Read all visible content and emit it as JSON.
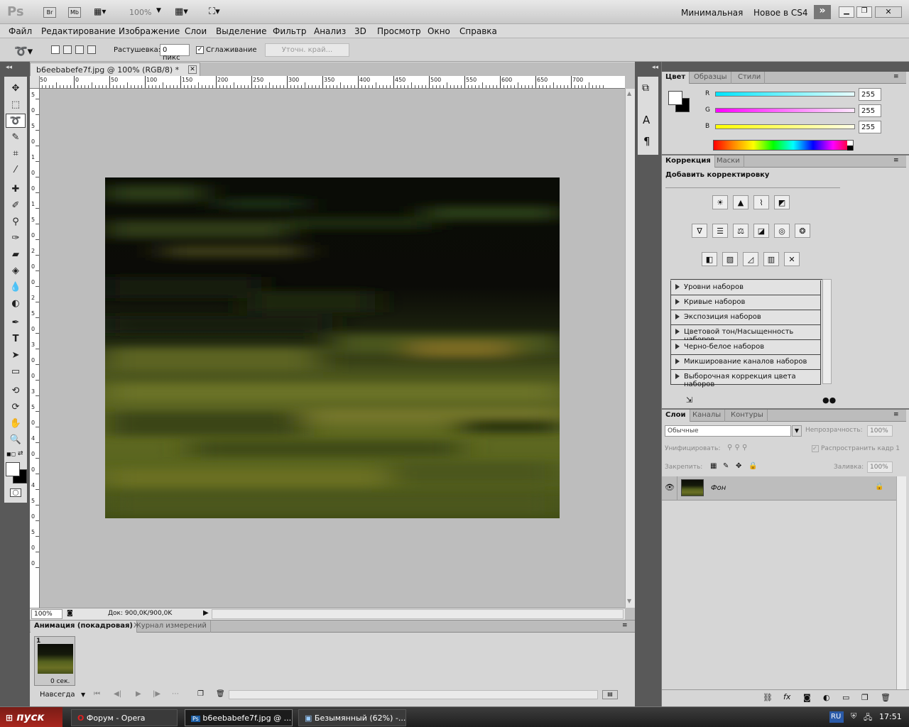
{
  "appbar": {
    "logo": "Ps",
    "br_btn": "Br",
    "mb_btn": "Mb",
    "zoom": "100%",
    "workspace_minimal": "Минимальная",
    "workspace_new": "Новое в CS4"
  },
  "menu": [
    "Файл",
    "Редактирование",
    "Изображение",
    "Слои",
    "Выделение",
    "Фильтр",
    "Анализ",
    "3D",
    "Просмотр",
    "Окно",
    "Справка"
  ],
  "options": {
    "feather_label": "Растушевка:",
    "feather_value": "0 пикс",
    "antialias_label": "Сглаживание",
    "refine_edge": "Уточн. край..."
  },
  "document": {
    "tab_title": "b6eebabefe7f.jpg @ 100% (RGB/8) *",
    "ruler_h_ticks": [
      "50",
      "0",
      "50",
      "100",
      "150",
      "200",
      "250",
      "300",
      "350",
      "400",
      "450",
      "500",
      "550",
      "600",
      "650",
      "700"
    ],
    "ruler_v_ticks": [
      "5",
      "0",
      "5",
      "0",
      "1",
      "0",
      "0",
      "1",
      "5",
      "0",
      "2",
      "0",
      "0",
      "2",
      "5",
      "0",
      "3",
      "0",
      "0",
      "3",
      "5",
      "0",
      "4",
      "0",
      "0",
      "4",
      "5",
      "0",
      "5",
      "0",
      "0"
    ],
    "zoom": "100%",
    "doc_info": "Док: 900,0K/900,0K"
  },
  "animation": {
    "tab_anim": "Анимация (покадровая)",
    "tab_measure": "Журнал измерений",
    "frame_number": "1",
    "frame_delay": "0 сек.",
    "loop": "Навсегда"
  },
  "color_panel": {
    "tabs": [
      "Цвет",
      "Образцы",
      "Стили"
    ],
    "channels": [
      {
        "label": "R",
        "value": "255",
        "color": "#00e5ff"
      },
      {
        "label": "G",
        "value": "255",
        "color": "#ff00ff"
      },
      {
        "label": "B",
        "value": "255",
        "color": "#ffff00"
      }
    ]
  },
  "adjustments": {
    "tabs": [
      "Коррекция",
      "Маски"
    ],
    "heading": "Добавить корректировку",
    "presets": [
      "Уровни наборов",
      "Кривые наборов",
      "Экспозиция наборов",
      "Цветовой тон/Насыщенность наборов",
      "Черно-белое наборов",
      "Микширование каналов наборов",
      "Выборочная коррекция цвета наборов"
    ]
  },
  "layers": {
    "tabs": [
      "Слои",
      "Каналы",
      "Контуры"
    ],
    "blend_mode": "Обычные",
    "opacity_label": "Непрозрачность:",
    "opacity_value": "100%",
    "unify_label": "Унифицировать:",
    "propagate_label": "Распространить кадр 1",
    "lock_label": "Закрепить:",
    "fill_label": "Заливка:",
    "fill_value": "100%",
    "layer_name": "Фон"
  },
  "taskbar": {
    "start": "пуск",
    "buttons": [
      "Форум - Opera",
      "b6eebabefe7f.jpg @ ...",
      "Безымянный (62%) -..."
    ],
    "lang": "RU",
    "time": "17:51"
  }
}
